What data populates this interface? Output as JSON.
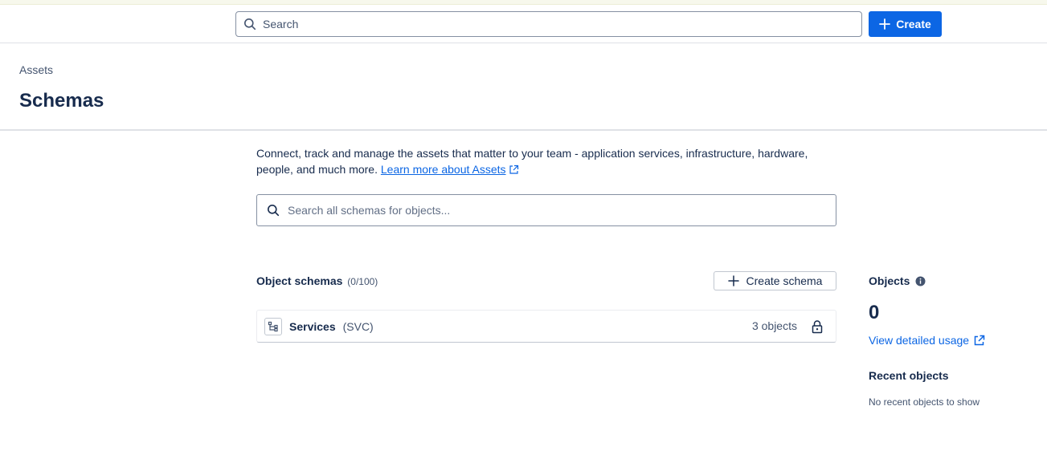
{
  "topbar": {
    "search_placeholder": "Search",
    "create_label": "Create"
  },
  "header": {
    "breadcrumb": "Assets",
    "title": "Schemas"
  },
  "intro": {
    "text": "Connect, track and manage the assets that matter to your team - application services, infrastructure, hardware, people, and much more.",
    "link_label": "Learn more about Assets"
  },
  "object_search": {
    "placeholder": "Search all schemas for objects..."
  },
  "schemas": {
    "heading": "Object schemas",
    "count": "(0/100)",
    "create_label": "Create schema",
    "items": [
      {
        "name": "Services",
        "key": "(SVC)",
        "objects": "3 objects",
        "icon": "schema-tree-icon",
        "locked": true
      }
    ]
  },
  "sidebar": {
    "objects_label": "Objects",
    "objects_value": "0",
    "usage_link": "View detailed usage",
    "recent_title": "Recent objects",
    "recent_empty": "No recent objects to show"
  },
  "colors": {
    "primary": "#0c66e4",
    "text": "#172b4d",
    "subtle_text": "#44546f",
    "border": "#dfe1e6"
  }
}
